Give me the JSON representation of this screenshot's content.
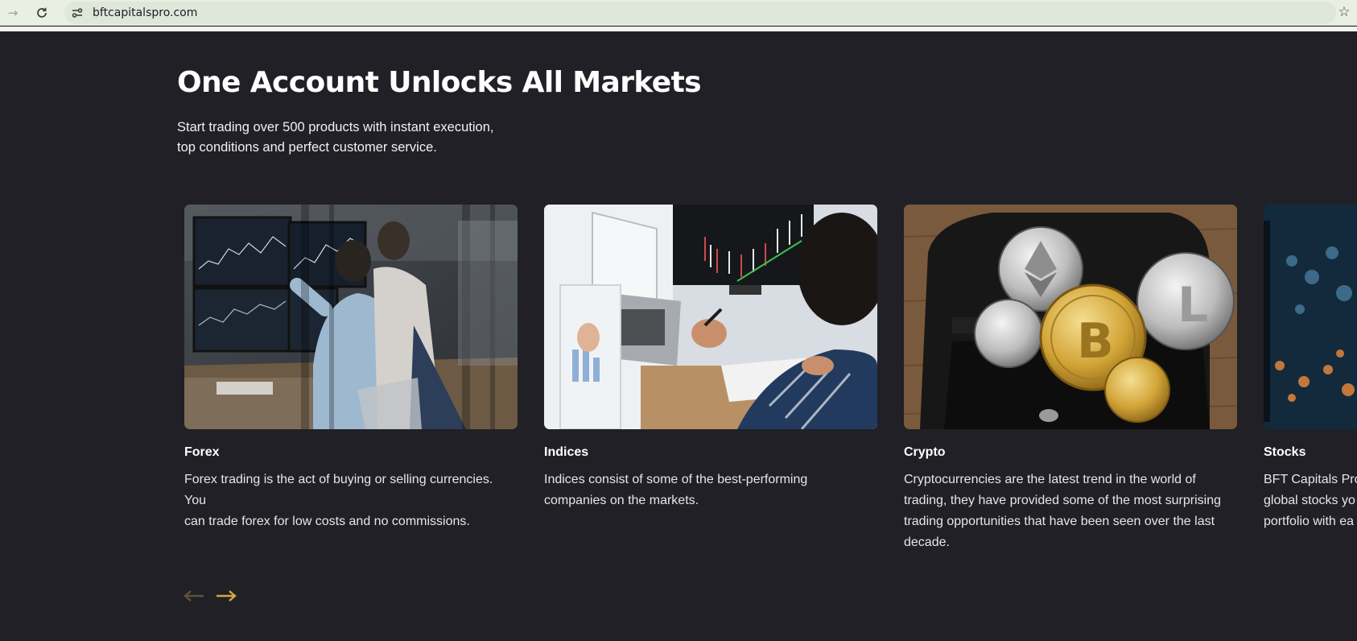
{
  "browser": {
    "url": "bftcapitalspro.com",
    "forward_icon": "arrow-forward-icon",
    "reload_icon": "reload-icon",
    "star_icon": "star-icon"
  },
  "section": {
    "title": "One Account Unlocks All Markets",
    "subtitle_line1": "Start trading over 500 products with instant execution,",
    "subtitle_line2": "top conditions and perfect customer service."
  },
  "cards": [
    {
      "title": "Forex",
      "desc_lines": [
        "Forex trading is the act of buying or selling currencies. You",
        "can trade forex for low costs and no commissions."
      ]
    },
    {
      "title": "Indices",
      "desc_lines": [
        "Indices consist of some of the best-performing",
        "companies on the markets."
      ]
    },
    {
      "title": "Crypto",
      "desc_lines": [
        "Cryptocurrencies are the latest trend in the world of",
        "trading, they have provided some of the most surprising",
        "trading opportunities that have been seen over the last",
        "decade."
      ]
    },
    {
      "title": "Stocks",
      "desc_lines": [
        "BFT Capitals Pro",
        "global stocks yo",
        "portfolio with ea"
      ]
    }
  ],
  "carousel": {
    "prev_icon": "arrow-left-icon",
    "next_icon": "arrow-right-icon",
    "prev_color": "#5e5334",
    "next_color": "#d4a93c"
  }
}
